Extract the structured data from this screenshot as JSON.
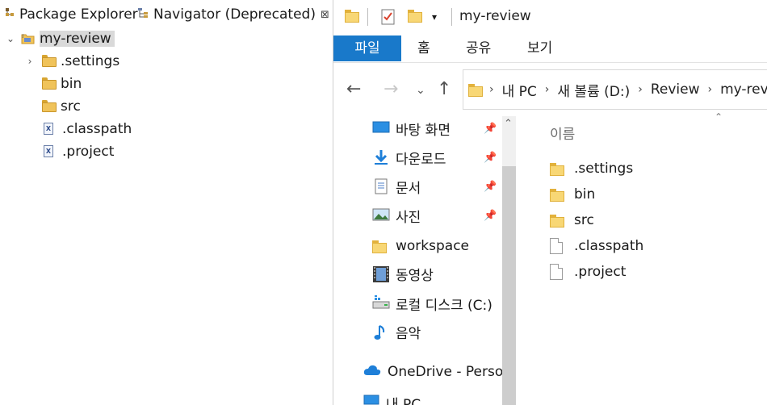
{
  "eclipse": {
    "tabs": [
      {
        "label": "Package Explorer"
      },
      {
        "label": "Navigator (Deprecated)",
        "close": "⊠"
      }
    ],
    "tree": {
      "project": "my-review",
      "children": [
        {
          "label": ".settings",
          "type": "folder",
          "expandable": true
        },
        {
          "label": "bin",
          "type": "folder"
        },
        {
          "label": "src",
          "type": "folder"
        },
        {
          "label": ".classpath",
          "type": "file"
        },
        {
          "label": ".project",
          "type": "file"
        }
      ]
    }
  },
  "explorer": {
    "title": "my-review",
    "ribbon_tabs": [
      "파일",
      "홈",
      "공유",
      "보기"
    ],
    "address": [
      "내 PC",
      "새 볼륨 (D:)",
      "Review",
      "my-review"
    ],
    "nav_items": [
      {
        "label": "바탕 화면",
        "icon": "desktop-icon",
        "pinned": true
      },
      {
        "label": "다운로드",
        "icon": "download-icon",
        "pinned": true
      },
      {
        "label": "문서",
        "icon": "document-icon",
        "pinned": true
      },
      {
        "label": "사진",
        "icon": "picture-icon",
        "pinned": true
      },
      {
        "label": "workspace",
        "icon": "folder-icon",
        "pinned": false
      },
      {
        "label": "동영상",
        "icon": "video-icon",
        "pinned": false
      },
      {
        "label": "로컬 디스크 (C:)",
        "icon": "drive-icon",
        "pinned": false
      },
      {
        "label": "음악",
        "icon": "music-icon",
        "pinned": false
      },
      {
        "label": "OneDrive - Personal",
        "icon": "onedrive-icon",
        "pinned": false
      },
      {
        "label": "내 PC",
        "icon": "pc-icon",
        "pinned": false
      }
    ],
    "column_header": "이름",
    "files": [
      {
        "name": ".settings",
        "type": "folder"
      },
      {
        "name": "bin",
        "type": "folder"
      },
      {
        "name": "src",
        "type": "folder"
      },
      {
        "name": ".classpath",
        "type": "file"
      },
      {
        "name": ".project",
        "type": "file"
      }
    ],
    "colors": {
      "file_tab": "#1979ca",
      "folder": "#f8d775"
    }
  }
}
